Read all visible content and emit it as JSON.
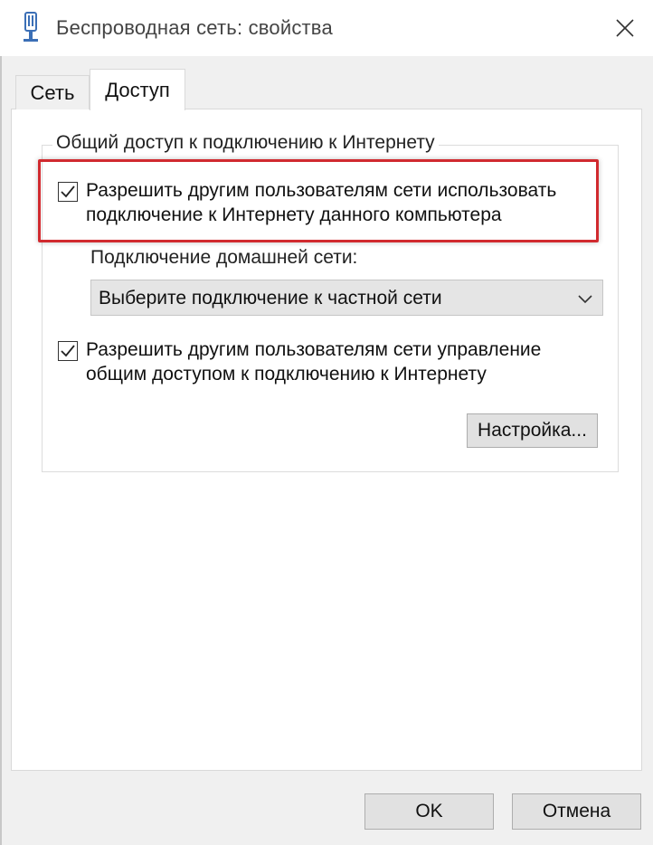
{
  "window": {
    "title": "Беспроводная сеть: свойства",
    "icon": "wireless-network-icon"
  },
  "tabs": [
    {
      "label": "Сеть",
      "active": false
    },
    {
      "label": "Доступ",
      "active": true
    }
  ],
  "sharing": {
    "group_title": "Общий доступ к подключению к Интернету",
    "allow_sharing": {
      "checked": true,
      "label": "Разрешить другим пользователям сети использовать подключение к Интернету данного компьютера"
    },
    "home_network_label": "Подключение домашней сети:",
    "home_network_select": {
      "value": "Выберите подключение к частной сети"
    },
    "allow_control": {
      "checked": true,
      "label": "Разрешить другим пользователям сети управление общим доступом к подключению к Интернету"
    },
    "settings_button": "Настройка..."
  },
  "footer": {
    "ok_label": "OK",
    "cancel_label": "Отмена"
  },
  "colors": {
    "highlight": "#d12a2f",
    "window_bg": "#f0f0f0",
    "panel_bg": "#ffffff"
  }
}
